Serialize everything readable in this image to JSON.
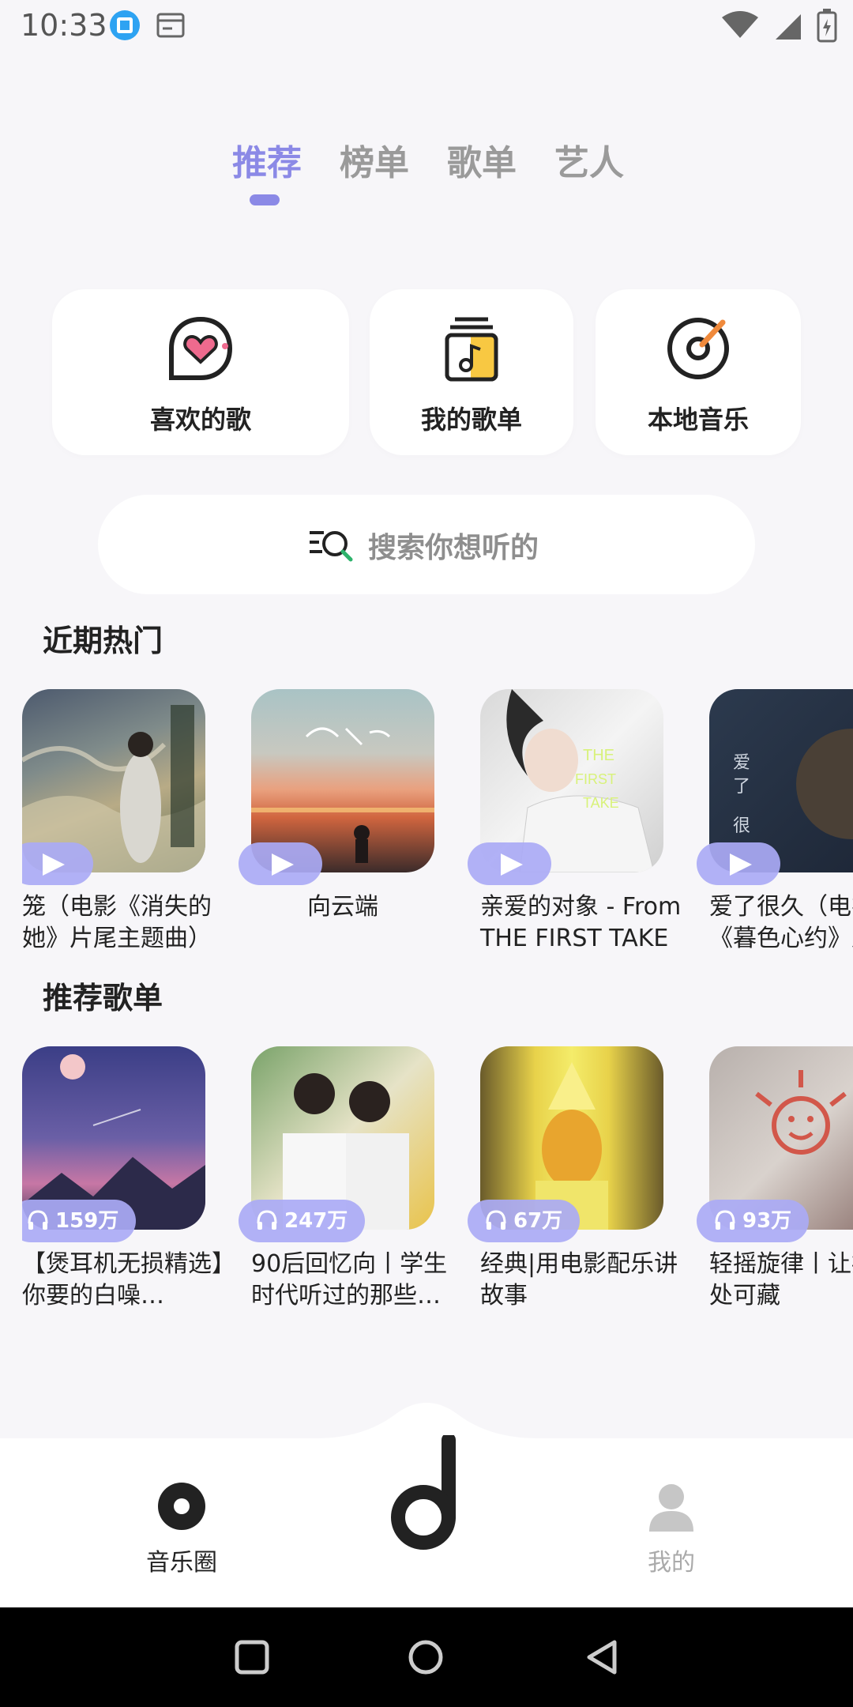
{
  "status": {
    "time": "10:33"
  },
  "tabs": [
    {
      "label": "推荐",
      "active": true
    },
    {
      "label": "榜单",
      "active": false
    },
    {
      "label": "歌单",
      "active": false
    },
    {
      "label": "艺人",
      "active": false
    }
  ],
  "quick": [
    {
      "label": "喜欢的歌",
      "icon": "heart-chat-icon"
    },
    {
      "label": "我的歌单",
      "icon": "playlist-icon"
    },
    {
      "label": "本地音乐",
      "icon": "vinyl-icon"
    }
  ],
  "search": {
    "placeholder": "搜索你想听的"
  },
  "sections": {
    "hot": "近期热门",
    "recommended": "推荐歌单"
  },
  "hot_songs": [
    {
      "title": "笼（电影《消失的她》片尾主题曲）"
    },
    {
      "title": "向云端"
    },
    {
      "title": "亲爱的对象 - From THE FIRST TAKE"
    },
    {
      "title": "爱了很久（电视剧《暮色心约》片"
    }
  ],
  "playlists": [
    {
      "count": "159万",
      "title": "【煲耳机无损精选】你要的白噪…"
    },
    {
      "count": "247万",
      "title": "90后回忆向丨学生时代听过的那些…"
    },
    {
      "count": "67万",
      "title": "经典|用电影配乐讲故事"
    },
    {
      "count": "93万",
      "title": "轻摇旋律丨让疲惫无处可藏"
    }
  ],
  "nav": {
    "left": "音乐圈",
    "right": "我的"
  },
  "colors": {
    "accent": "#8b89e6",
    "pill": "#aaaaf5",
    "background": "#f7f6f9"
  }
}
